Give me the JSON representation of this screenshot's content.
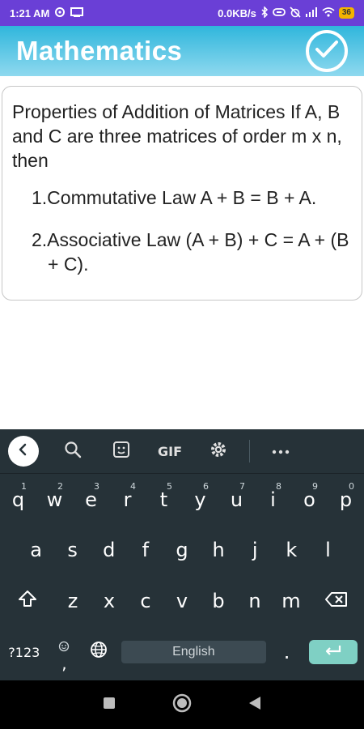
{
  "status_bar": {
    "time": "1:21 AM",
    "network_speed": "0.0KB/s",
    "battery_level": "36"
  },
  "app_bar": {
    "title": "Mathematics"
  },
  "content": {
    "intro": "Properties of Addition of Matrices If A, B and C are three matrices of order m x n, then",
    "laws": [
      "1.Commutative Law A + B = B + A.",
      "2.Associative Law (A + B) + C = A + (B + C)."
    ]
  },
  "keyboard": {
    "gif_label": "GIF",
    "row1": [
      {
        "key": "q",
        "hint": "1"
      },
      {
        "key": "w",
        "hint": "2"
      },
      {
        "key": "e",
        "hint": "3"
      },
      {
        "key": "r",
        "hint": "4"
      },
      {
        "key": "t",
        "hint": "5"
      },
      {
        "key": "y",
        "hint": "6"
      },
      {
        "key": "u",
        "hint": "7"
      },
      {
        "key": "i",
        "hint": "8"
      },
      {
        "key": "o",
        "hint": "9"
      },
      {
        "key": "p",
        "hint": "0"
      }
    ],
    "row2": [
      "a",
      "s",
      "d",
      "f",
      "g",
      "h",
      "j",
      "k",
      "l"
    ],
    "row3": [
      "z",
      "x",
      "c",
      "v",
      "b",
      "n",
      "m"
    ],
    "symbols_label": "?123",
    "comma": ",",
    "space_label": "English",
    "period": "."
  },
  "colors": {
    "status_bar": "#6a3fd6",
    "app_bar": "#2fb6dc",
    "keyboard_bg": "#263238",
    "enter_key": "#7fd0c4"
  }
}
